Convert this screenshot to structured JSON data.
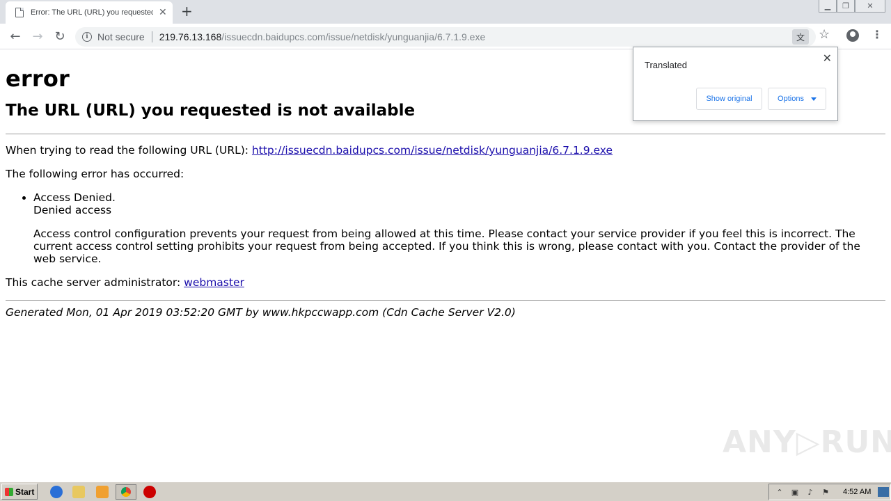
{
  "browser": {
    "tab_title": "Error: The URL (URL) you requested",
    "tab_close": "✕",
    "new_tab": "+",
    "security_label": "Not secure",
    "url_host": "219.76.13.168",
    "url_path": "/issuecdn.baidupcs.com/issue/netdisk/yunguanjia/6.7.1.9.exe"
  },
  "translate_bubble": {
    "title": "Translated",
    "show_original": "Show original",
    "options": "Options",
    "close": "✕"
  },
  "page": {
    "h1": "error",
    "h2": "The URL (URL) you requested is not available",
    "read_prefix": "When trying to read the following URL (URL): ",
    "read_url": "http://issuecdn.baidupcs.com/issue/netdisk/yunguanjia/6.7.1.9.exe",
    "error_intro": "The following error has occurred:",
    "bullet_title": "Access Denied.",
    "bullet_sub": "Denied access",
    "detail_line1": "Access control configuration prevents your request from being allowed at this time. Please contact your service provider if you feel this is incorrect. The",
    "detail_line2": "current access control setting prohibits your request from being accepted. If you think this is wrong, please contact with you. Contact the provider of the web service.",
    "admin_prefix": "This cache server administrator: ",
    "admin_link": "webmaster",
    "footer": "Generated Mon, 01 Apr 2019 03:52:20 GMT by www.hkpccwapp.com (Cdn Cache Server V2.0)"
  },
  "taskbar": {
    "start_label": "Start",
    "clock": "4:52 AM"
  },
  "watermark": "ANY▷RUN"
}
